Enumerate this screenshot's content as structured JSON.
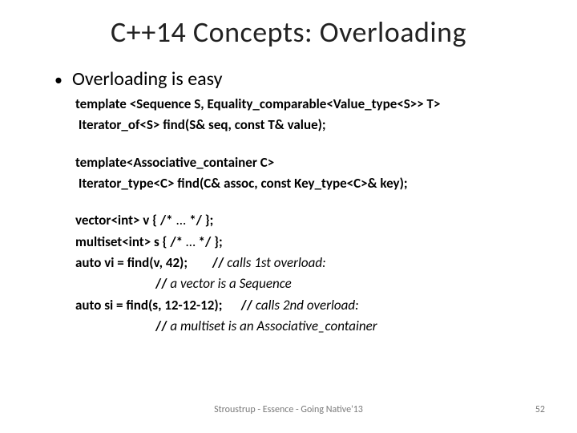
{
  "title": "C++14 Concepts: Overloading",
  "bullet": "Overloading is easy",
  "code": {
    "l1": "template <Sequence S, Equality_comparable<Value_type<S>> T>",
    "l2": " Iterator_of<S> find(S& seq, const T& value);",
    "l3": "template<Associative_container C>",
    "l4": " Iterator_type<C> find(C& assoc, const Key_type<C>& key);",
    "l5": "vector<int> v { /* ",
    "l5b": "... ",
    "l5c": "*/ };",
    "l6": "multiset<int> s { /* ",
    "l6b": "… ",
    "l6c": "*/ };",
    "l7a": "auto vi = find(v, 42);        // ",
    "l7b": "calls 1st overload:",
    "l8a": "                          // ",
    "l8b": "a vector is a Sequence",
    "l9a": "auto si = find(s, 12-12-12);      // ",
    "l9b": "calls 2nd overload:",
    "l10a": "                          // ",
    "l10b": "a multiset is an Associative_container"
  },
  "footer": "Stroustrup - Essence - Going Native'13",
  "page": "52"
}
